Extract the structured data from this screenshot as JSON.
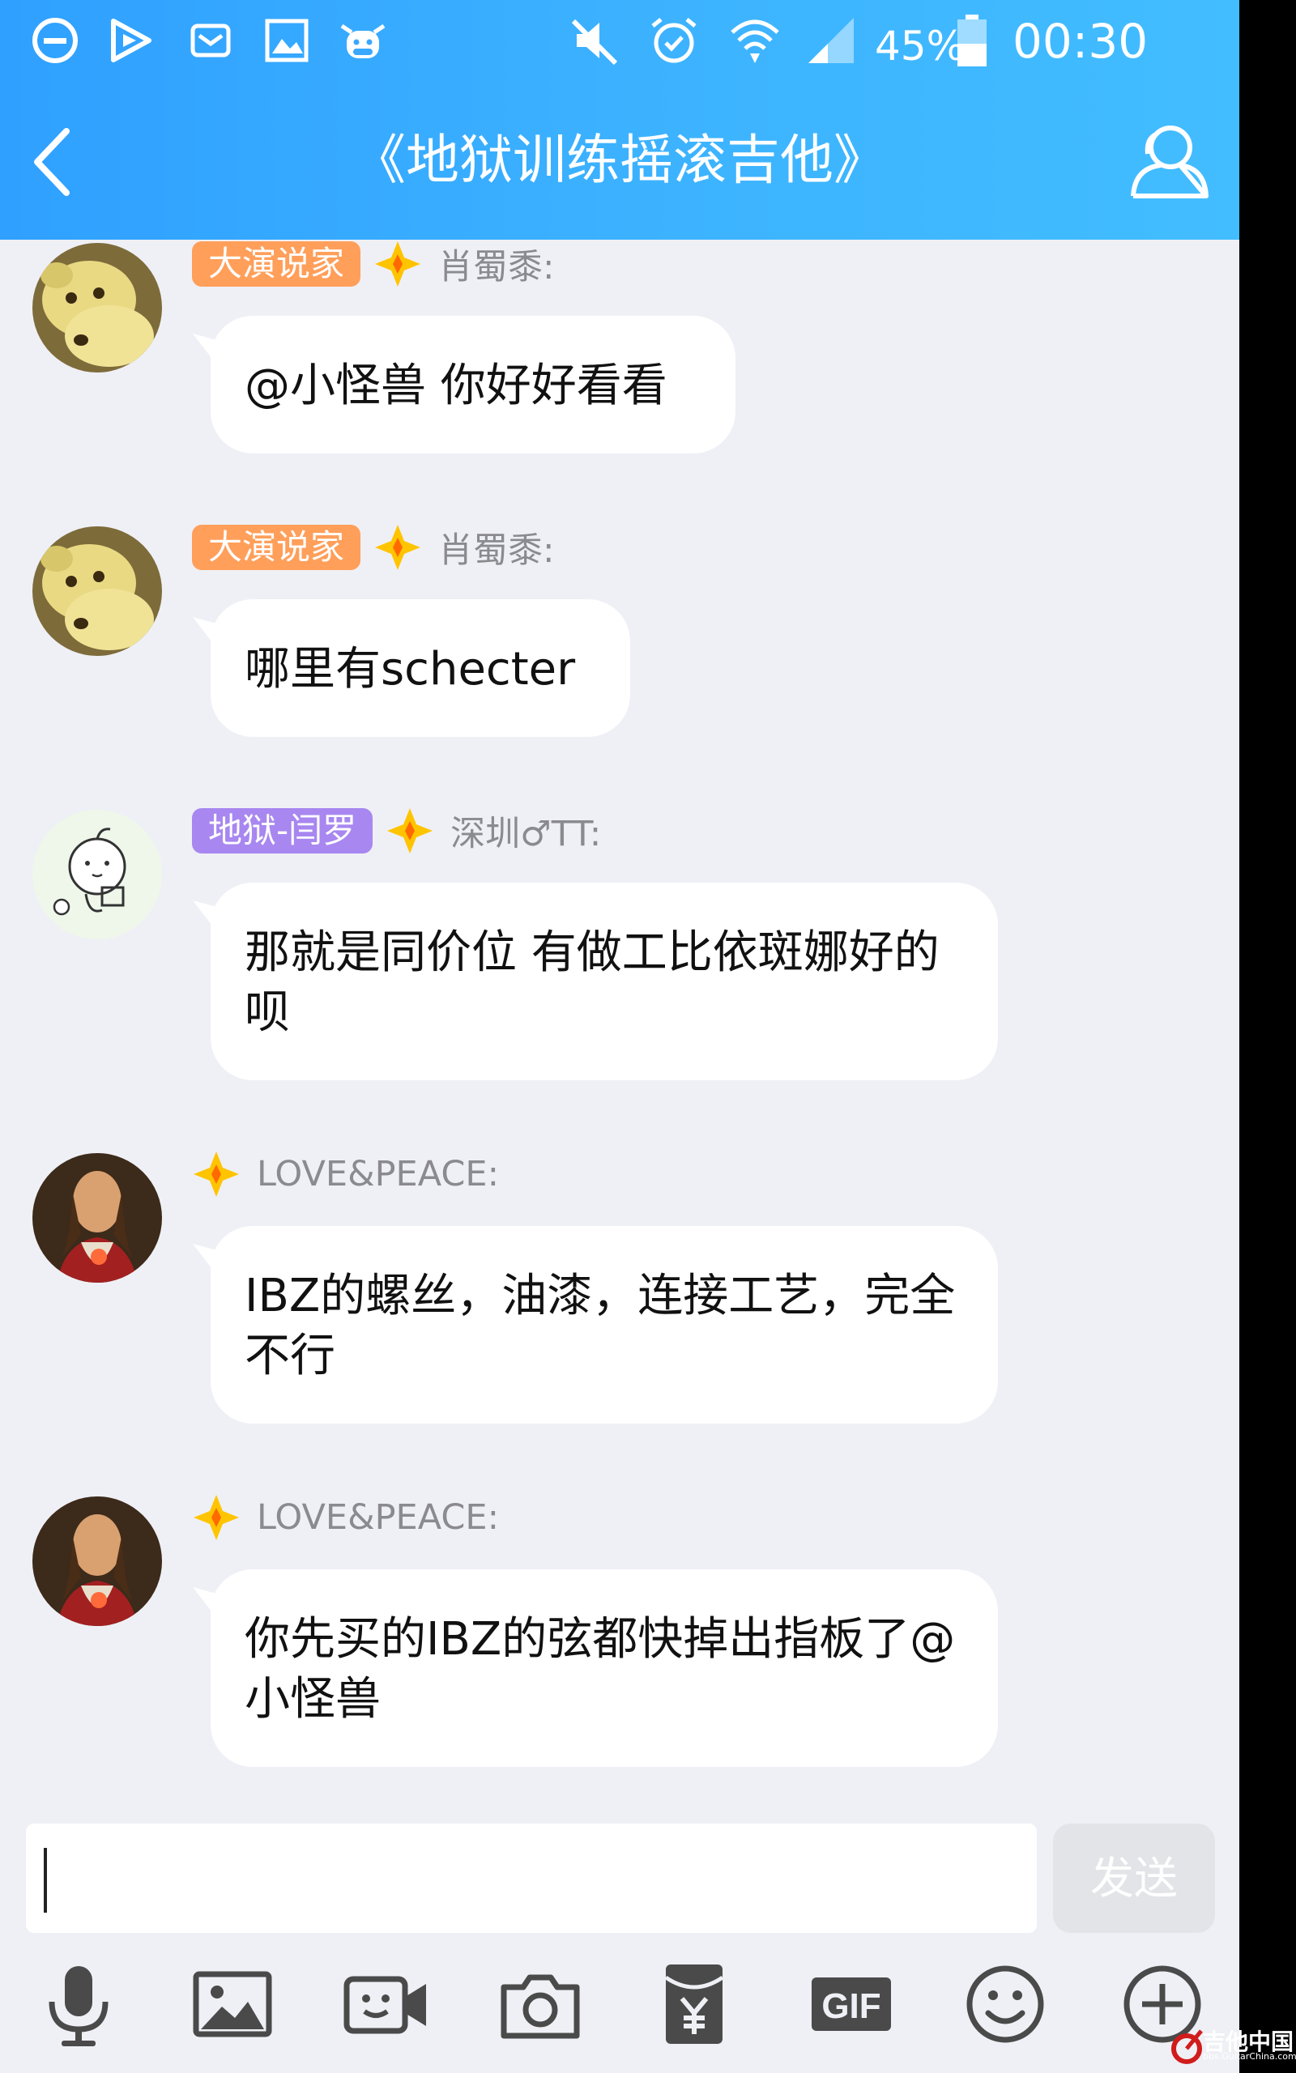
{
  "status_bar": {
    "icons": [
      "do-not-disturb-icon",
      "play-icon",
      "mail-icon",
      "gallery-icon",
      "cow-app-icon",
      "mute-icon",
      "alarm-icon",
      "wifi-icon",
      "signal-icon",
      "battery-icon"
    ],
    "battery": "45%",
    "time": "00:30"
  },
  "header": {
    "title": "《地狱训练摇滚吉他》",
    "back_icon": "chevron-left-icon",
    "members_icon": "group-members-icon"
  },
  "messages": [
    {
      "badge": "大演说家",
      "badge_color": "#ff9f5a",
      "sender": "肖蜀黍:",
      "text": "@小怪兽 你好好看看",
      "avatar": "teddy-bear"
    },
    {
      "badge": "大演说家",
      "badge_color": "#ff9f5a",
      "sender": "肖蜀黍:",
      "text": "哪里有schecter",
      "avatar": "teddy-bear"
    },
    {
      "badge": "地狱-闫罗",
      "badge_color": "#a887f0",
      "sender": "深圳♂TT:",
      "text": "那就是同价位 有做工比依斑娜好的呗",
      "avatar": "cartoon-sketch"
    },
    {
      "badge": "",
      "sender": "LOVE&PEACE:",
      "text": "IBZ的螺丝，油漆，连接工艺，完全不行",
      "avatar": "portrait-painting"
    },
    {
      "badge": "",
      "sender": "LOVE&PEACE:",
      "text": "你先买的IBZ的弦都快掉出指板了@小怪兽",
      "avatar": "portrait-painting"
    }
  ],
  "composer": {
    "input_value": "",
    "send_label": "发送"
  },
  "toolbar": [
    {
      "icon": "microphone-icon"
    },
    {
      "icon": "image-icon"
    },
    {
      "icon": "video-call-icon"
    },
    {
      "icon": "camera-icon"
    },
    {
      "icon": "red-packet-icon"
    },
    {
      "icon": "gif-icon",
      "label": "GIF"
    },
    {
      "icon": "emoji-icon"
    },
    {
      "icon": "plus-icon"
    }
  ],
  "watermark": {
    "text": "吉他中国",
    "sub": "bbs.GuitarChina.com"
  },
  "colors": {
    "header_start": "#2fa0ff",
    "header_end": "#42bdff",
    "background": "#eff0f5",
    "star": "#ffc400"
  }
}
